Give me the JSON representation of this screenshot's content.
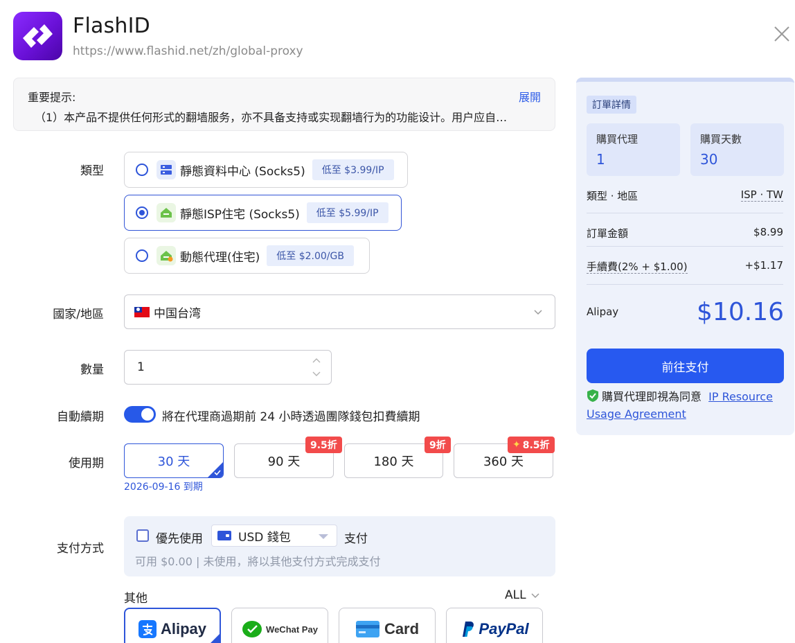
{
  "header": {
    "app_name": "FlashID",
    "url": "https://www.flashid.net/zh/global-proxy"
  },
  "notice": {
    "title": "重要提示:",
    "expand_label": "展開",
    "text": "（1）本产品不提供任何形式的翻墙服务，亦不具备支持或实现翻墙行为的功能设计。用户应自…"
  },
  "form": {
    "type_label": "類型",
    "types": [
      {
        "label": "靜態資料中心 (Socks5)",
        "price": "低至 $3.99/IP",
        "icon": "server-icon",
        "selected": false
      },
      {
        "label": "靜態ISP住宅 (Socks5)",
        "price": "低至 $5.99/IP",
        "icon": "home-icon",
        "selected": true
      },
      {
        "label": "動態代理(住宅)",
        "price": "低至 $2.00/GB",
        "icon": "home-dynamic-icon",
        "selected": false
      }
    ],
    "region_label": "國家/地區",
    "region_value": "中国台湾",
    "quantity_label": "數量",
    "quantity_value": "1",
    "auto_renew_label": "自動續期",
    "auto_renew_on": true,
    "auto_renew_text": "將在代理商過期前 24 小時透過團隊錢包扣費續期",
    "period_label": "使用期",
    "periods": [
      {
        "label": "30 天",
        "badge": "",
        "selected": true
      },
      {
        "label": "90 天",
        "badge": "9.5折",
        "selected": false
      },
      {
        "label": "180 天",
        "badge": "9折",
        "selected": false
      },
      {
        "label": "360 天",
        "badge": "8.5折",
        "selected": false
      }
    ],
    "expire_text": "2026-09-16 到期",
    "payment_label": "支付方式",
    "wallet_prefix": "優先使用",
    "wallet_name": "USD 錢包",
    "wallet_suffix": "支付",
    "wallet_hint": "可用 $0.00 | 未使用，將以其他支付方式完成支付",
    "others_label": "其他",
    "filter_label": "ALL",
    "methods": [
      {
        "label": "Alipay",
        "selected": true
      },
      {
        "label": "WeChat Pay",
        "selected": false
      },
      {
        "label": "Card",
        "selected": false
      },
      {
        "label": "PayPal",
        "selected": false
      }
    ]
  },
  "summary": {
    "tag": "訂單詳情",
    "proxy_count_label": "購買代理",
    "proxy_count": "1",
    "days_label": "購買天數",
    "days": "30",
    "type_region_label": "類型 · 地區",
    "type_region_value": "ISP · TW",
    "amount_label": "訂單金額",
    "amount_value": "$8.99",
    "fee_label": "手續費(2% + $1.00)",
    "fee_value": "+$1.17",
    "method_label": "Alipay",
    "total": "$10.16",
    "pay_button": "前往支付",
    "agree_text": "購買代理即視為同意",
    "agree_link": "IP Resource Usage Agreement"
  },
  "colors": {
    "accent": "#2e55d9",
    "pay_button": "#2759f0",
    "badge": "#f24b4b",
    "logo": "#7a1ff0"
  }
}
